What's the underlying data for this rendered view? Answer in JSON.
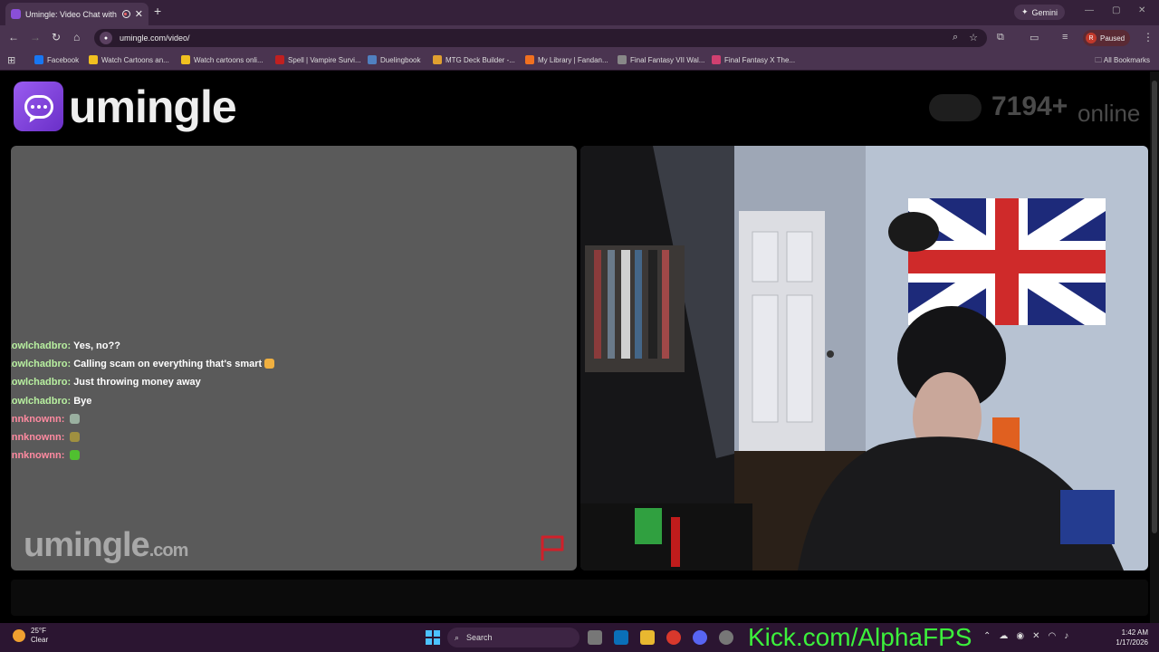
{
  "browser": {
    "tab_title": "Umingle: Video Chat with S",
    "close_glyph": "✕",
    "new_tab_glyph": "+",
    "gemini_label": "Gemini",
    "url": "umingle.com/video/",
    "profile_initial": "R",
    "profile_status": "Paused",
    "all_bookmarks": "All Bookmarks",
    "bookmarks": [
      {
        "label": "Facebook",
        "color": "#1877f2"
      },
      {
        "label": "Watch Cartoons an...",
        "color": "#f0c020"
      },
      {
        "label": "Watch cartoons onli...",
        "color": "#f0c020"
      },
      {
        "label": "Spell | Vampire Survi...",
        "color": "#c02020"
      },
      {
        "label": "Duelingbook",
        "color": "#5080c0"
      },
      {
        "label": "MTG Deck Builder -...",
        "color": "#e0a030"
      },
      {
        "label": "My Library | Fandan...",
        "color": "#f07020"
      },
      {
        "label": "Final Fantasy VII Wal...",
        "color": "#888888"
      },
      {
        "label": "Final Fantasy X The...",
        "color": "#d04070"
      }
    ]
  },
  "site": {
    "logo_text": "umingle",
    "online_count": "7194+",
    "online_word": "online",
    "watermark_main": "umingle",
    "watermark_suffix": ".com"
  },
  "chat": [
    {
      "user": "Lowlchadbro",
      "text": "Yes, no??",
      "user_type": "stranger",
      "emoji_color": ""
    },
    {
      "user": "Lowlchadbro",
      "text": "Calling scam on everything that's smart",
      "user_type": "stranger",
      "emoji_color": "#f0b040"
    },
    {
      "user": "Lowlchadbro",
      "text": "Just throwing money away",
      "user_type": "stranger",
      "emoji_color": ""
    },
    {
      "user": "Lowlchadbro",
      "text": "Bye",
      "user_type": "stranger",
      "emoji_color": ""
    },
    {
      "user": "unnknownn",
      "text": "",
      "user_type": "self",
      "emoji_color": "#9ab0a0"
    },
    {
      "user": "unnknownn",
      "text": "",
      "user_type": "self",
      "emoji_color": "#a09040"
    },
    {
      "user": "unnknownn",
      "text": "",
      "user_type": "self",
      "emoji_color": "#50c030"
    }
  ],
  "taskbar": {
    "temp": "25°F",
    "condition": "Clear",
    "search_label": "Search",
    "overlay_text": "Kick.com/AlphaFPS",
    "time": "1:42 AM",
    "date": "1/17/2026"
  },
  "colors": {
    "accent": "#8a4fd8",
    "stranger_name": "#b8f0a0",
    "self_name": "#ff8aa0",
    "overlay_green": "#3cf03c"
  }
}
